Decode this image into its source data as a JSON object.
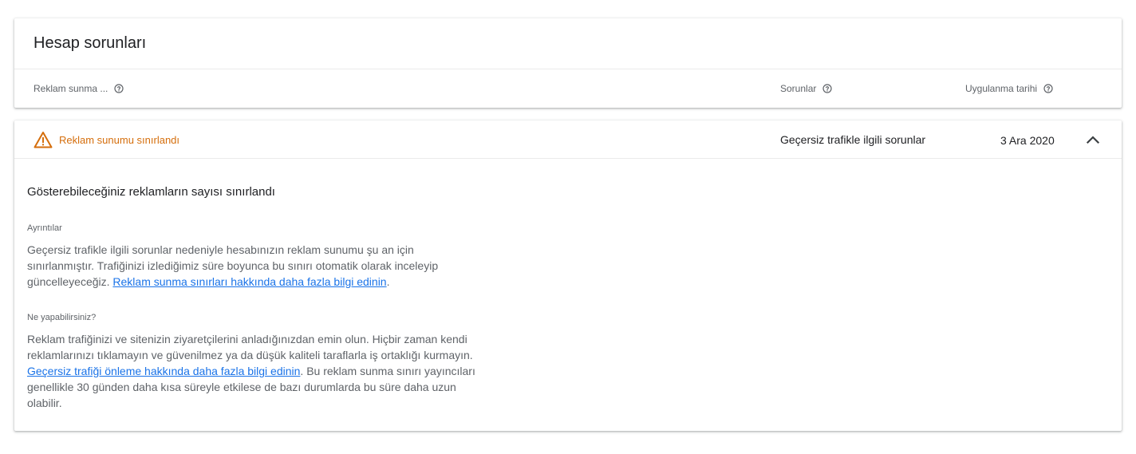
{
  "header": {
    "title": "Hesap sorunları",
    "columns": [
      {
        "label": "Reklam sunma ...",
        "help_icon": "help-circle-icon"
      },
      {
        "label": "Sorunlar",
        "help_icon": "help-circle-icon"
      },
      {
        "label": "Uygulanma tarihi",
        "help_icon": "help-circle-icon"
      }
    ]
  },
  "issue": {
    "status_icon": "warning-triangle-icon",
    "status": "Reklam sunumu sınırlandı",
    "type": "Geçersiz trafikle ilgili sorunlar",
    "date": "3 Ara 2020",
    "expand_icon": "chevron-up-icon",
    "detail_title": "Gösterebileceğiniz reklamların sayısı sınırlandı",
    "details_label": "Ayrıntılar",
    "details_text": "Geçersiz trafikle ilgili sorunlar nedeniyle hesabınızın reklam sunumu şu an için sınırlanmıştır. Trafiğinizi izlediğimiz süre boyunca bu sınırı otomatik olarak inceleyip güncelleyeceğiz. ",
    "details_link": "Reklam sunma sınırları hakkında daha fazla bilgi edinin",
    "details_end": ".",
    "action_label": "Ne yapabilirsiniz?",
    "action_text": "Reklam trafiğinizi ve sitenizin ziyaretçilerini anladığınızdan emin olun. Hiçbir zaman kendi reklamlarınızı tıklamayın ve güvenilmez ya da düşük kaliteli taraflarla iş ortaklığı kurmayın. ",
    "action_link": "Geçersiz trafiği önleme hakkında daha fazla bilgi edinin",
    "action_end": ". Bu reklam sunma sınırı yayıncıları genellikle 30 günden daha kısa süreyle etkilese de bazı durumlarda bu süre daha uzun olabilir."
  },
  "colors": {
    "warning": "#d56e0c",
    "link": "#1a73e8"
  }
}
